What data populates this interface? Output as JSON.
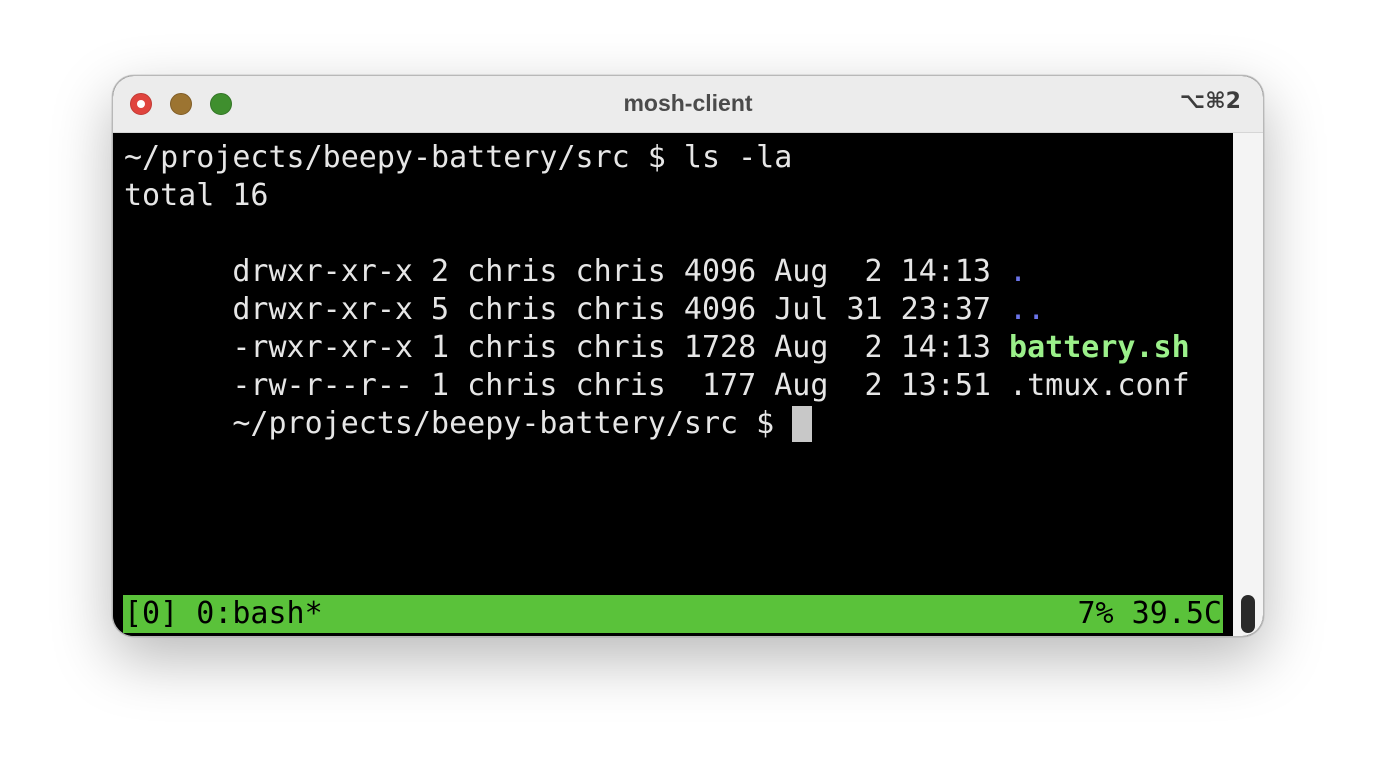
{
  "window": {
    "title": "mosh-client",
    "shortcut": "⌥⌘2"
  },
  "terminal": {
    "prompt_line": "~/projects/beepy-battery/src $ ls -la",
    "total_line": "total 16",
    "entries": [
      {
        "perms_meta": "drwxr-xr-x 2 chris chris 4096 Aug  2 14:13",
        "name": "."
      },
      {
        "perms_meta": "drwxr-xr-x 5 chris chris 4096 Jul 31 23:37",
        "name": ".."
      },
      {
        "perms_meta": "-rwxr-xr-x 1 chris chris 1728 Aug  2 14:13",
        "name": "battery.sh"
      },
      {
        "perms_meta": "-rw-r--r-- 1 chris chris  177 Aug  2 13:51",
        "name": ".tmux.conf"
      }
    ],
    "current_prompt": "~/projects/beepy-battery/src $ "
  },
  "tmux_status": {
    "left": "[0] 0:bash*",
    "right": "7% 39.5C"
  },
  "colors": {
    "directory": "#6b74e8",
    "executable": "#9bf08a",
    "status_bar": "#5ac23a",
    "terminal_bg": "#000000",
    "terminal_fg": "#e6e6e6"
  },
  "icons": {
    "close": "close-icon",
    "minimize": "minimize-icon",
    "zoom": "zoom-icon"
  }
}
